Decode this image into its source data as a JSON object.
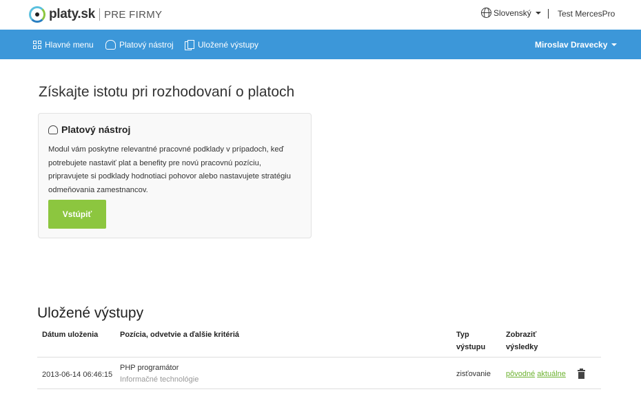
{
  "header": {
    "brand_name": "platy.sk",
    "brand_sub": "PRE FIRMY",
    "language": "Slovenský",
    "account": "Test MercesPro"
  },
  "nav": {
    "items": [
      {
        "label": "Hlavné menu",
        "icon": "grid-icon"
      },
      {
        "label": "Platový nástroj",
        "icon": "hand-icon"
      },
      {
        "label": "Uložené výstupy",
        "icon": "pages-icon"
      }
    ],
    "user": "Miroslav Dravecky"
  },
  "hero": {
    "title": "Získajte istotu pri rozhodovaní o platoch"
  },
  "card": {
    "title": "Platový nástroj",
    "description": "Modul vám poskytne relevantné pracovné podklady v prípadoch, keď potrebujete nastaviť plat a benefity pre novú pracovnú pozíciu, pripravujete si podklady hodnotiaci pohovor alebo nastavujete stratégiu odmeňovania zamestnancov.",
    "button": "Vstúpiť"
  },
  "saved": {
    "title": "Uložené výstupy",
    "columns": {
      "date": "Dátum uloženia",
      "position": "Pozícia, odvetvie a ďalšie kritériá",
      "type_line1": "Typ",
      "type_line2": "výstupu",
      "show_line1": "Zobraziť",
      "show_line2": "výsledky"
    },
    "rows": [
      {
        "date": "2013-06-14 06:46:15",
        "position": "PHP programátor",
        "industry": "Informačné technológie",
        "type": "zisťovanie",
        "link_original": "pôvodné",
        "link_current": "aktuálne"
      }
    ]
  },
  "colors": {
    "nav_bg": "#3c97d9",
    "button_green": "#8cc63f",
    "link_green": "#6cb22f"
  }
}
